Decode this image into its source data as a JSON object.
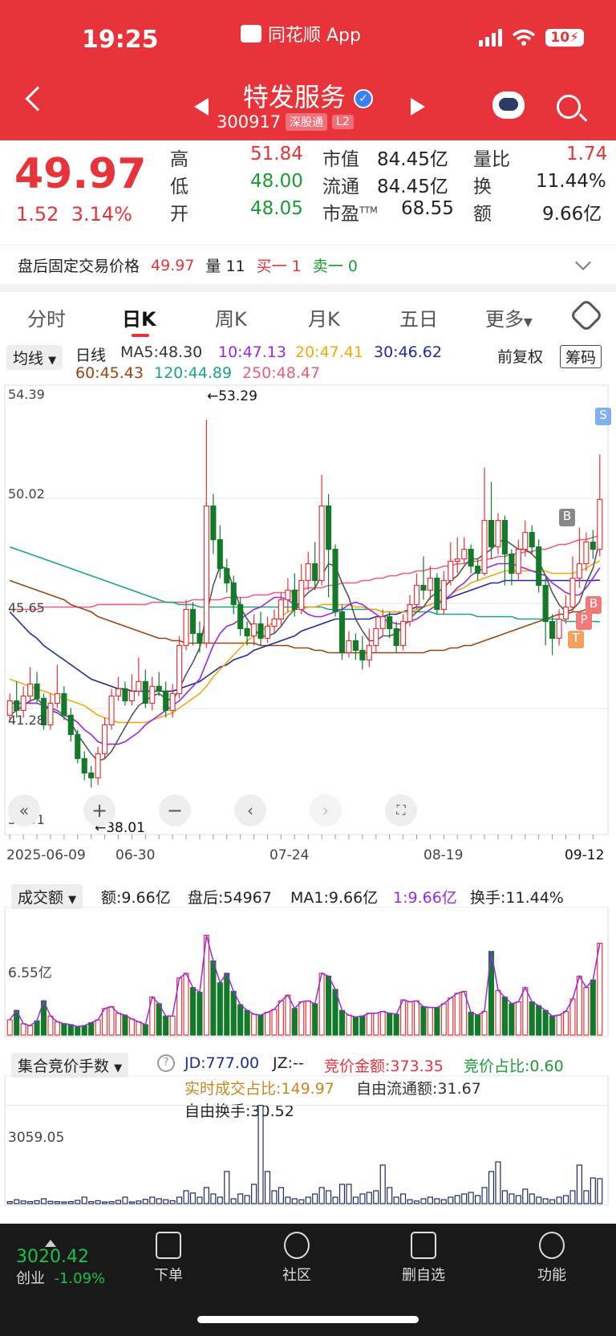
{
  "status": {
    "time": "19:25",
    "app": "同花顺 App",
    "battery": "10"
  },
  "stock": {
    "name": "特发服务",
    "code": "300917",
    "tags": [
      "深股通",
      "L2"
    ]
  },
  "quote": {
    "price": "49.97",
    "change": "1.52",
    "pct": "3.14%",
    "high_l": "高",
    "high": "51.84",
    "low_l": "低",
    "low": "48.00",
    "open_l": "开",
    "open": "48.05",
    "mcap_l": "市值",
    "mcap": "84.45亿",
    "float_l": "流通",
    "float": "84.45亿",
    "pe_l": "市盈",
    "pe_sup": "TTM",
    "pe": "68.55",
    "vr_l": "量比",
    "vr": "1.74",
    "turn_l": "换",
    "turn": "11.44%",
    "amt_l": "额",
    "amt": "9.66亿"
  },
  "after": {
    "label": "盘后固定交易价格",
    "price": "49.97",
    "vol": "量 11",
    "buy": "买一 1",
    "sell": "卖一 0"
  },
  "tabs": [
    "分时",
    "日K",
    "周K",
    "月K",
    "五日",
    "更多"
  ],
  "legend": {
    "ma_btn": "均线",
    "kind": "日线",
    "ma5": "MA5:48.30",
    "ma10": "10:47.13",
    "ma20": "20:47.41",
    "ma30": "30:46.62",
    "ma60": "60:45.43",
    "ma120": "120:44.89",
    "ma250": "250:48.47",
    "adj": "前复权",
    "chips": "筹码"
  },
  "chart": {
    "yticks": [
      "54.39",
      "50.02",
      "45.65",
      "41.28",
      "36.91"
    ],
    "max_label": "←53.29",
    "min_label": "←38.01",
    "dates": [
      "2025-06-09",
      "06-30",
      "07-24",
      "08-19",
      "09-12"
    ],
    "markers": [
      "S",
      "B",
      "B",
      "P",
      "T"
    ]
  },
  "volume": {
    "btn": "成交额",
    "amt": "额:9.66亿",
    "after": "盘后:54967",
    "ma1": "MA1:9.66亿",
    "ma1b": "1:9.66亿",
    "turn": "换手:11.44%",
    "ytick": "6.55亿"
  },
  "bid": {
    "btn": "集合竞价手数",
    "jd": "JD:777.00",
    "jz": "JZ:--",
    "amt": "竞价金额:373.35",
    "ratio": "竞价占比:0.60",
    "rt": "实时成交占比:149.97",
    "free": "自由流通额:31.67",
    "freeturn": "自由换手:30.52",
    "ytick": "3059.05"
  },
  "bottom": {
    "idx_val": "3020.42",
    "idx_name": "创业",
    "idx_pct": "-1.09%",
    "nav": [
      "下单",
      "社区",
      "删自选",
      "功能"
    ]
  },
  "chart_data": {
    "type": "candlestick",
    "ylim": [
      36.91,
      54.39
    ],
    "x_start": "2025-06-09",
    "x_end": "2025-09-12",
    "candles": [
      [
        41.0,
        41.6,
        40.7,
        41.9
      ],
      [
        41.6,
        41.2,
        40.9,
        42.4
      ],
      [
        41.2,
        41.8,
        40.9,
        42.2
      ],
      [
        41.8,
        42.3,
        41.5,
        43.0
      ],
      [
        42.3,
        41.7,
        41.5,
        42.8
      ],
      [
        41.7,
        40.6,
        40.4,
        41.9
      ],
      [
        40.6,
        41.5,
        40.4,
        41.9
      ],
      [
        41.5,
        41.9,
        41.3,
        43.1
      ],
      [
        41.9,
        41.0,
        40.8,
        42.2
      ],
      [
        41.0,
        40.2,
        39.9,
        41.3
      ],
      [
        40.2,
        39.2,
        39.0,
        40.4
      ],
      [
        39.2,
        38.6,
        38.3,
        39.5
      ],
      [
        38.6,
        38.4,
        38.0,
        38.9
      ],
      [
        38.4,
        39.4,
        38.1,
        39.7
      ],
      [
        39.4,
        40.6,
        39.2,
        40.9
      ],
      [
        40.6,
        41.8,
        40.4,
        42.1
      ],
      [
        41.8,
        42.1,
        41.6,
        42.6
      ],
      [
        42.1,
        41.6,
        41.4,
        42.4
      ],
      [
        41.6,
        42.0,
        41.4,
        42.7
      ],
      [
        42.0,
        42.4,
        41.8,
        43.4
      ],
      [
        42.4,
        41.5,
        41.3,
        42.9
      ],
      [
        41.5,
        42.2,
        41.2,
        42.6
      ],
      [
        42.2,
        42.0,
        41.8,
        42.8
      ],
      [
        42.0,
        41.2,
        40.9,
        42.4
      ],
      [
        41.2,
        41.9,
        40.9,
        42.3
      ],
      [
        41.9,
        43.9,
        41.7,
        44.3
      ],
      [
        43.9,
        45.4,
        43.7,
        45.8
      ],
      [
        45.4,
        44.4,
        43.9,
        45.7
      ],
      [
        44.4,
        44.0,
        43.6,
        44.9
      ],
      [
        44.0,
        49.7,
        43.8,
        53.29
      ],
      [
        49.7,
        48.3,
        47.7,
        50.2
      ],
      [
        48.3,
        47.1,
        46.7,
        48.9
      ],
      [
        47.1,
        46.5,
        46.1,
        47.5
      ],
      [
        46.5,
        45.6,
        45.2,
        46.8
      ],
      [
        45.6,
        44.6,
        44.3,
        45.9
      ],
      [
        44.6,
        44.3,
        43.9,
        44.9
      ],
      [
        44.3,
        44.8,
        43.9,
        45.2
      ],
      [
        44.8,
        44.2,
        43.9,
        45.3
      ],
      [
        44.2,
        44.7,
        44.0,
        45.1
      ],
      [
        44.7,
        45.0,
        44.4,
        45.4
      ],
      [
        45.0,
        45.8,
        44.7,
        46.1
      ],
      [
        45.8,
        46.2,
        45.3,
        46.7
      ],
      [
        46.2,
        45.4,
        45.1,
        46.9
      ],
      [
        45.4,
        46.6,
        45.2,
        47.3
      ],
      [
        46.6,
        47.3,
        46.2,
        47.8
      ],
      [
        47.3,
        46.6,
        46.2,
        48.2
      ],
      [
        46.6,
        49.7,
        46.4,
        51.0
      ],
      [
        49.7,
        47.9,
        45.9,
        50.2
      ],
      [
        47.9,
        45.3,
        45.1,
        48.1
      ],
      [
        45.3,
        43.6,
        43.3,
        45.6
      ],
      [
        43.6,
        44.1,
        43.4,
        44.5
      ],
      [
        44.1,
        43.7,
        43.3,
        44.4
      ],
      [
        43.7,
        43.3,
        42.9,
        44.3
      ],
      [
        43.3,
        43.9,
        43.0,
        44.6
      ],
      [
        43.9,
        44.6,
        43.6,
        45.1
      ],
      [
        44.6,
        45.1,
        44.3,
        45.4
      ],
      [
        45.1,
        44.6,
        44.2,
        45.3
      ],
      [
        44.6,
        43.9,
        43.6,
        44.9
      ],
      [
        43.9,
        44.9,
        43.7,
        45.2
      ],
      [
        44.9,
        45.6,
        44.7,
        46.0
      ],
      [
        45.6,
        46.4,
        45.4,
        46.9
      ],
      [
        46.4,
        46.2,
        45.8,
        47.6
      ],
      [
        46.2,
        46.7,
        45.8,
        47.2
      ],
      [
        46.7,
        45.4,
        45.2,
        46.9
      ],
      [
        45.4,
        46.6,
        45.2,
        47.0
      ],
      [
        46.6,
        47.4,
        46.4,
        48.2
      ],
      [
        47.4,
        47.5,
        46.9,
        48.4
      ],
      [
        47.5,
        47.9,
        47.3,
        48.4
      ],
      [
        47.9,
        47.2,
        46.9,
        48.1
      ],
      [
        47.2,
        46.9,
        46.6,
        47.5
      ],
      [
        46.9,
        49.1,
        46.8,
        51.3
      ],
      [
        49.1,
        48.0,
        47.5,
        50.7
      ],
      [
        48.0,
        49.1,
        47.7,
        49.4
      ],
      [
        49.1,
        47.7,
        46.4,
        49.3
      ],
      [
        47.7,
        46.9,
        46.4,
        47.9
      ],
      [
        46.9,
        47.9,
        46.6,
        48.3
      ],
      [
        47.9,
        48.6,
        47.6,
        49.1
      ],
      [
        48.6,
        48.0,
        47.7,
        48.9
      ],
      [
        48.0,
        46.4,
        46.1,
        48.3
      ],
      [
        46.4,
        44.9,
        43.9,
        46.7
      ],
      [
        44.9,
        44.2,
        43.5,
        45.2
      ],
      [
        44.2,
        45.0,
        43.9,
        45.4
      ],
      [
        45.0,
        45.5,
        44.8,
        46.0
      ],
      [
        45.5,
        46.7,
        45.3,
        47.6
      ],
      [
        46.7,
        47.3,
        46.3,
        48.8
      ],
      [
        47.3,
        48.2,
        47.0,
        48.6
      ],
      [
        48.2,
        47.9,
        47.5,
        48.7
      ],
      [
        47.9,
        49.97,
        47.6,
        51.84
      ]
    ],
    "ma5": [
      41.0,
      41.2,
      41.4,
      41.6,
      41.7,
      41.4,
      41.2,
      41.1,
      40.9,
      40.7,
      40.2,
      39.8,
      39.4,
      39.1,
      39.2,
      39.5,
      40.0,
      40.5,
      41.0,
      41.4,
      41.6,
      41.8,
      41.9,
      41.7,
      41.6,
      42.1,
      42.7,
      43.2,
      43.8,
      45.2,
      46.4,
      47.2,
      47.1,
      46.3,
      45.5,
      45.0,
      44.6,
      44.3,
      44.3,
      44.4,
      44.7,
      45.1,
      45.4,
      45.8,
      46.1,
      46.3,
      46.8,
      47.3,
      47.2,
      46.5,
      45.9,
      45.0,
      44.5,
      44.1,
      44.1,
      44.3,
      44.3,
      44.4,
      44.7,
      45.0,
      45.3,
      45.5,
      45.9,
      46.1,
      46.3,
      46.6,
      46.8,
      47.2,
      47.5,
      47.5,
      47.7,
      47.9,
      48.2,
      48.3,
      48.1,
      47.9,
      47.9,
      47.7,
      47.4,
      46.8,
      46.1,
      45.6,
      45.3,
      45.4,
      45.7,
      46.5,
      47.1,
      48.3
    ],
    "ma10": [
      41.5,
      41.5,
      41.5,
      41.5,
      41.5,
      41.4,
      41.3,
      41.2,
      41.0,
      40.9,
      40.7,
      40.4,
      40.2,
      39.9,
      39.8,
      39.8,
      39.8,
      39.9,
      40.1,
      40.3,
      40.6,
      40.8,
      41.0,
      41.2,
      41.4,
      41.6,
      41.9,
      42.2,
      42.5,
      43.2,
      43.9,
      44.4,
      44.7,
      44.8,
      45.0,
      45.2,
      45.4,
      45.5,
      45.7,
      45.9,
      45.9,
      45.8,
      45.6,
      45.4,
      45.2,
      45.1,
      45.1,
      45.2,
      45.3,
      45.4,
      45.6,
      45.7,
      45.6,
      45.4,
      45.2,
      45.0,
      44.9,
      44.8,
      44.8,
      44.9,
      45.0,
      45.2,
      45.4,
      45.6,
      45.8,
      46.0,
      46.3,
      46.5,
      46.8,
      47.0,
      47.1,
      47.2,
      47.3,
      47.3,
      47.3,
      47.2,
      47.1,
      47.0,
      46.9,
      46.8,
      46.5,
      46.3,
      46.1,
      46.0,
      46.0,
      46.3,
      46.7,
      47.13
    ],
    "ma20": [
      42.5,
      42.4,
      42.3,
      42.2,
      42.1,
      42.0,
      41.9,
      41.8,
      41.7,
      41.6,
      41.5,
      41.4,
      41.2,
      41.0,
      40.9,
      40.8,
      40.7,
      40.7,
      40.7,
      40.7,
      40.7,
      40.8,
      40.9,
      41.0,
      41.1,
      41.3,
      41.5,
      41.7,
      41.9,
      42.2,
      42.6,
      42.9,
      43.2,
      43.5,
      43.8,
      44.1,
      44.3,
      44.5,
      44.7,
      44.9,
      45.1,
      45.3,
      45.4,
      45.4,
      45.5,
      45.5,
      45.6,
      45.6,
      45.6,
      45.6,
      45.6,
      45.5,
      45.5,
      45.4,
      45.4,
      45.3,
      45.3,
      45.3,
      45.3,
      45.3,
      45.4,
      45.5,
      45.6,
      45.7,
      45.8,
      46.0,
      46.2,
      46.3,
      46.5,
      46.6,
      46.7,
      46.8,
      46.9,
      47.0,
      47.0,
      47.0,
      47.0,
      47.0,
      47.0,
      47.0,
      46.9,
      46.9,
      46.9,
      46.9,
      47.0,
      47.1,
      47.3,
      47.41
    ],
    "ma30": [
      45.3,
      45.0,
      44.7,
      44.4,
      44.2,
      43.9,
      43.7,
      43.5,
      43.3,
      43.1,
      42.9,
      42.7,
      42.5,
      42.4,
      42.3,
      42.2,
      42.1,
      42.1,
      42.0,
      42.0,
      42.0,
      42.0,
      42.0,
      42.0,
      42.0,
      42.1,
      42.2,
      42.3,
      42.4,
      42.6,
      42.8,
      43.0,
      43.1,
      43.3,
      43.4,
      43.5,
      43.7,
      43.8,
      43.9,
      44.0,
      44.1,
      44.2,
      44.3,
      44.5,
      44.6,
      44.7,
      44.8,
      44.9,
      45.0,
      45.0,
      45.0,
      45.0,
      45.0,
      45.0,
      45.1,
      45.1,
      45.2,
      45.2,
      45.3,
      45.4,
      45.5,
      45.5,
      45.6,
      45.7,
      45.8,
      45.9,
      46.0,
      46.1,
      46.2,
      46.3,
      46.4,
      46.5,
      46.5,
      46.6,
      46.6,
      46.6,
      46.6,
      46.6,
      46.6,
      46.6,
      46.6,
      46.6,
      46.6,
      46.6,
      46.6,
      46.6,
      46.6,
      46.62
    ],
    "ma60": [
      46.6,
      46.5,
      46.4,
      46.3,
      46.2,
      46.1,
      46.0,
      45.9,
      45.8,
      45.6,
      45.5,
      45.4,
      45.3,
      45.1,
      45.0,
      44.9,
      44.8,
      44.7,
      44.6,
      44.5,
      44.4,
      44.3,
      44.2,
      44.2,
      44.1,
      44.1,
      44.0,
      44.0,
      44.0,
      44.0,
      44.0,
      44.0,
      44.0,
      44.0,
      44.0,
      44.0,
      44.0,
      43.9,
      43.9,
      43.9,
      43.9,
      43.9,
      43.8,
      43.8,
      43.8,
      43.7,
      43.7,
      43.6,
      43.6,
      43.6,
      43.6,
      43.6,
      43.6,
      43.6,
      43.6,
      43.6,
      43.6,
      43.6,
      43.6,
      43.6,
      43.6,
      43.6,
      43.7,
      43.7,
      43.7,
      43.8,
      43.8,
      43.9,
      43.9,
      44.0,
      44.1,
      44.2,
      44.3,
      44.4,
      44.5,
      44.6,
      44.7,
      44.8,
      44.9,
      45.0,
      45.1,
      45.2,
      45.2,
      45.3,
      45.3,
      45.4,
      45.4,
      45.43
    ],
    "ma120": [
      48.0,
      47.9,
      47.8,
      47.7,
      47.6,
      47.5,
      47.4,
      47.3,
      47.2,
      47.1,
      47.0,
      46.9,
      46.8,
      46.7,
      46.6,
      46.5,
      46.4,
      46.3,
      46.2,
      46.1,
      46.0,
      45.9,
      45.8,
      45.7,
      45.7,
      45.6,
      45.6,
      45.6,
      45.5,
      45.5,
      45.5,
      45.5,
      45.5,
      45.5,
      45.5,
      45.5,
      45.5,
      45.5,
      45.5,
      45.5,
      45.5,
      45.5,
      45.5,
      45.5,
      45.5,
      45.5,
      45.5,
      45.4,
      45.4,
      45.4,
      45.4,
      45.4,
      45.4,
      45.4,
      45.4,
      45.3,
      45.3,
      45.3,
      45.3,
      45.3,
      45.3,
      45.3,
      45.3,
      45.2,
      45.2,
      45.2,
      45.2,
      45.2,
      45.2,
      45.1,
      45.1,
      45.1,
      45.1,
      45.1,
      45.1,
      45.0,
      45.0,
      45.0,
      45.0,
      45.0,
      45.0,
      45.0,
      44.9,
      44.9,
      44.9,
      44.9,
      44.9,
      44.89
    ],
    "ma250": [
      45.4,
      45.4,
      45.4,
      45.4,
      45.4,
      45.5,
      45.5,
      45.5,
      45.5,
      45.5,
      45.5,
      45.5,
      45.5,
      45.6,
      45.6,
      45.6,
      45.6,
      45.6,
      45.6,
      45.6,
      45.6,
      45.7,
      45.7,
      45.7,
      45.7,
      45.7,
      45.7,
      45.8,
      45.8,
      45.8,
      45.8,
      45.8,
      45.9,
      45.9,
      45.9,
      45.9,
      46.0,
      46.0,
      46.0,
      46.1,
      46.1,
      46.1,
      46.2,
      46.2,
      46.3,
      46.3,
      46.3,
      46.4,
      46.4,
      46.5,
      46.5,
      46.5,
      46.6,
      46.6,
      46.7,
      46.7,
      46.8,
      46.8,
      46.9,
      46.9,
      47.0,
      47.0,
      47.1,
      47.1,
      47.2,
      47.2,
      47.3,
      47.3,
      47.4,
      47.4,
      47.5,
      47.5,
      47.6,
      47.6,
      47.7,
      47.7,
      47.8,
      47.8,
      47.9,
      47.9,
      48.0,
      48.1,
      48.1,
      48.2,
      48.3,
      48.3,
      48.4,
      48.47
    ],
    "volume_ymax": 13,
    "volume": [
      1.6,
      2.6,
      1.2,
      1.0,
      1.5,
      3.6,
      2.0,
      1.4,
      1.2,
      1.1,
      0.9,
      1.0,
      1.3,
      1.6,
      2.8,
      3.0,
      2.3,
      2.1,
      1.7,
      1.4,
      1.1,
      4.0,
      3.3,
      2.0,
      2.0,
      6.0,
      6.5,
      5.0,
      4.5,
      10.5,
      7.8,
      5.5,
      6.5,
      4.6,
      3.2,
      2.6,
      2.2,
      2.1,
      2.4,
      2.7,
      3.6,
      4.2,
      2.8,
      3.5,
      3.6,
      3.3,
      6.5,
      6.2,
      4.8,
      2.6,
      2.1,
      1.9,
      2.0,
      2.3,
      2.3,
      2.5,
      2.3,
      2.2,
      3.7,
      3.5,
      3.6,
      3.0,
      2.9,
      2.9,
      3.3,
      3.9,
      4.4,
      4.6,
      2.4,
      2.1,
      2.5,
      8.8,
      4.7,
      4.0,
      3.3,
      3.5,
      5.0,
      3.5,
      3.1,
      2.6,
      2.0,
      2.1,
      2.5,
      3.8,
      6.2,
      5.0,
      5.8,
      9.66
    ],
    "bid_ymax": 3900,
    "bid": [
      60,
      120,
      80,
      60,
      90,
      150,
      70,
      60,
      50,
      60,
      100,
      200,
      60,
      90,
      50,
      60,
      100,
      200,
      50,
      80,
      130,
      200,
      150,
      120,
      90,
      200,
      400,
      330,
      200,
      500,
      300,
      200,
      1000,
      150,
      300,
      250,
      600,
      3059,
      1000,
      400,
      500,
      200,
      150,
      120,
      200,
      300,
      500,
      400,
      200,
      600,
      600,
      200,
      300,
      350,
      400,
      1200,
      500,
      200,
      300,
      120,
      80,
      150,
      200,
      150,
      120,
      200,
      250,
      300,
      350,
      250,
      500,
      1000,
      1300,
      400,
      300,
      250,
      450,
      300,
      200,
      150,
      120,
      200,
      250,
      400,
      1200,
      400,
      800,
      777
    ]
  }
}
